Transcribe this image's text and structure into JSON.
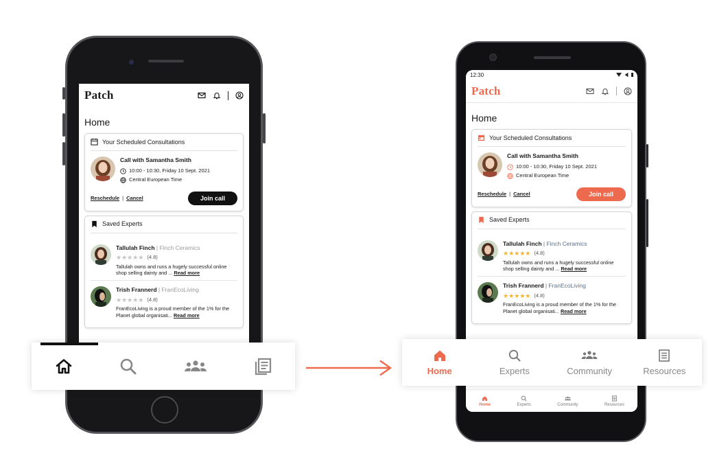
{
  "colors": {
    "accent": "#ee6a4f",
    "black": "#111111",
    "star_gold": "#f3b432",
    "star_gray": "#c4c4c4",
    "company_blue": "#5a6e8a"
  },
  "app": {
    "brand": "Patch",
    "page_title": "Home",
    "status_time": "12:30"
  },
  "consultations": {
    "title": "Your Scheduled Consultations",
    "call_title": "Call with Samantha Smith",
    "time": "10:00 - 10:30, Friday 10 Sept. 2021",
    "timezone": "Central European Time",
    "reschedule": "Reschedule",
    "separator": "|",
    "cancel": "Cancel",
    "join": "Join call"
  },
  "saved_experts": {
    "title": "Saved Experts",
    "experts": [
      {
        "name": "Tallulah Finch",
        "company": "| Finch Ceramics",
        "rating": "(4.8)",
        "rating_value": 4.8,
        "desc": "Tallulah owns and runs a hugely successful online shop selling dainty and ...",
        "read_more": "Read more"
      },
      {
        "name": "Trish Frannerd",
        "company": "| FranEcoLiving",
        "rating": "(4.8)",
        "rating_value": 4.8,
        "desc": "FranEcoLiving is a proud member of the 1% for the Planet global organisati...",
        "read_more": "Read more"
      }
    ]
  },
  "tabs": [
    {
      "label": "Home",
      "icon": "home-icon",
      "active": true
    },
    {
      "label": "Experts",
      "icon": "search-icon",
      "active": false
    },
    {
      "label": "Community",
      "icon": "community-icon",
      "active": false
    },
    {
      "label": "Resources",
      "icon": "resources-icon",
      "active": false
    }
  ]
}
